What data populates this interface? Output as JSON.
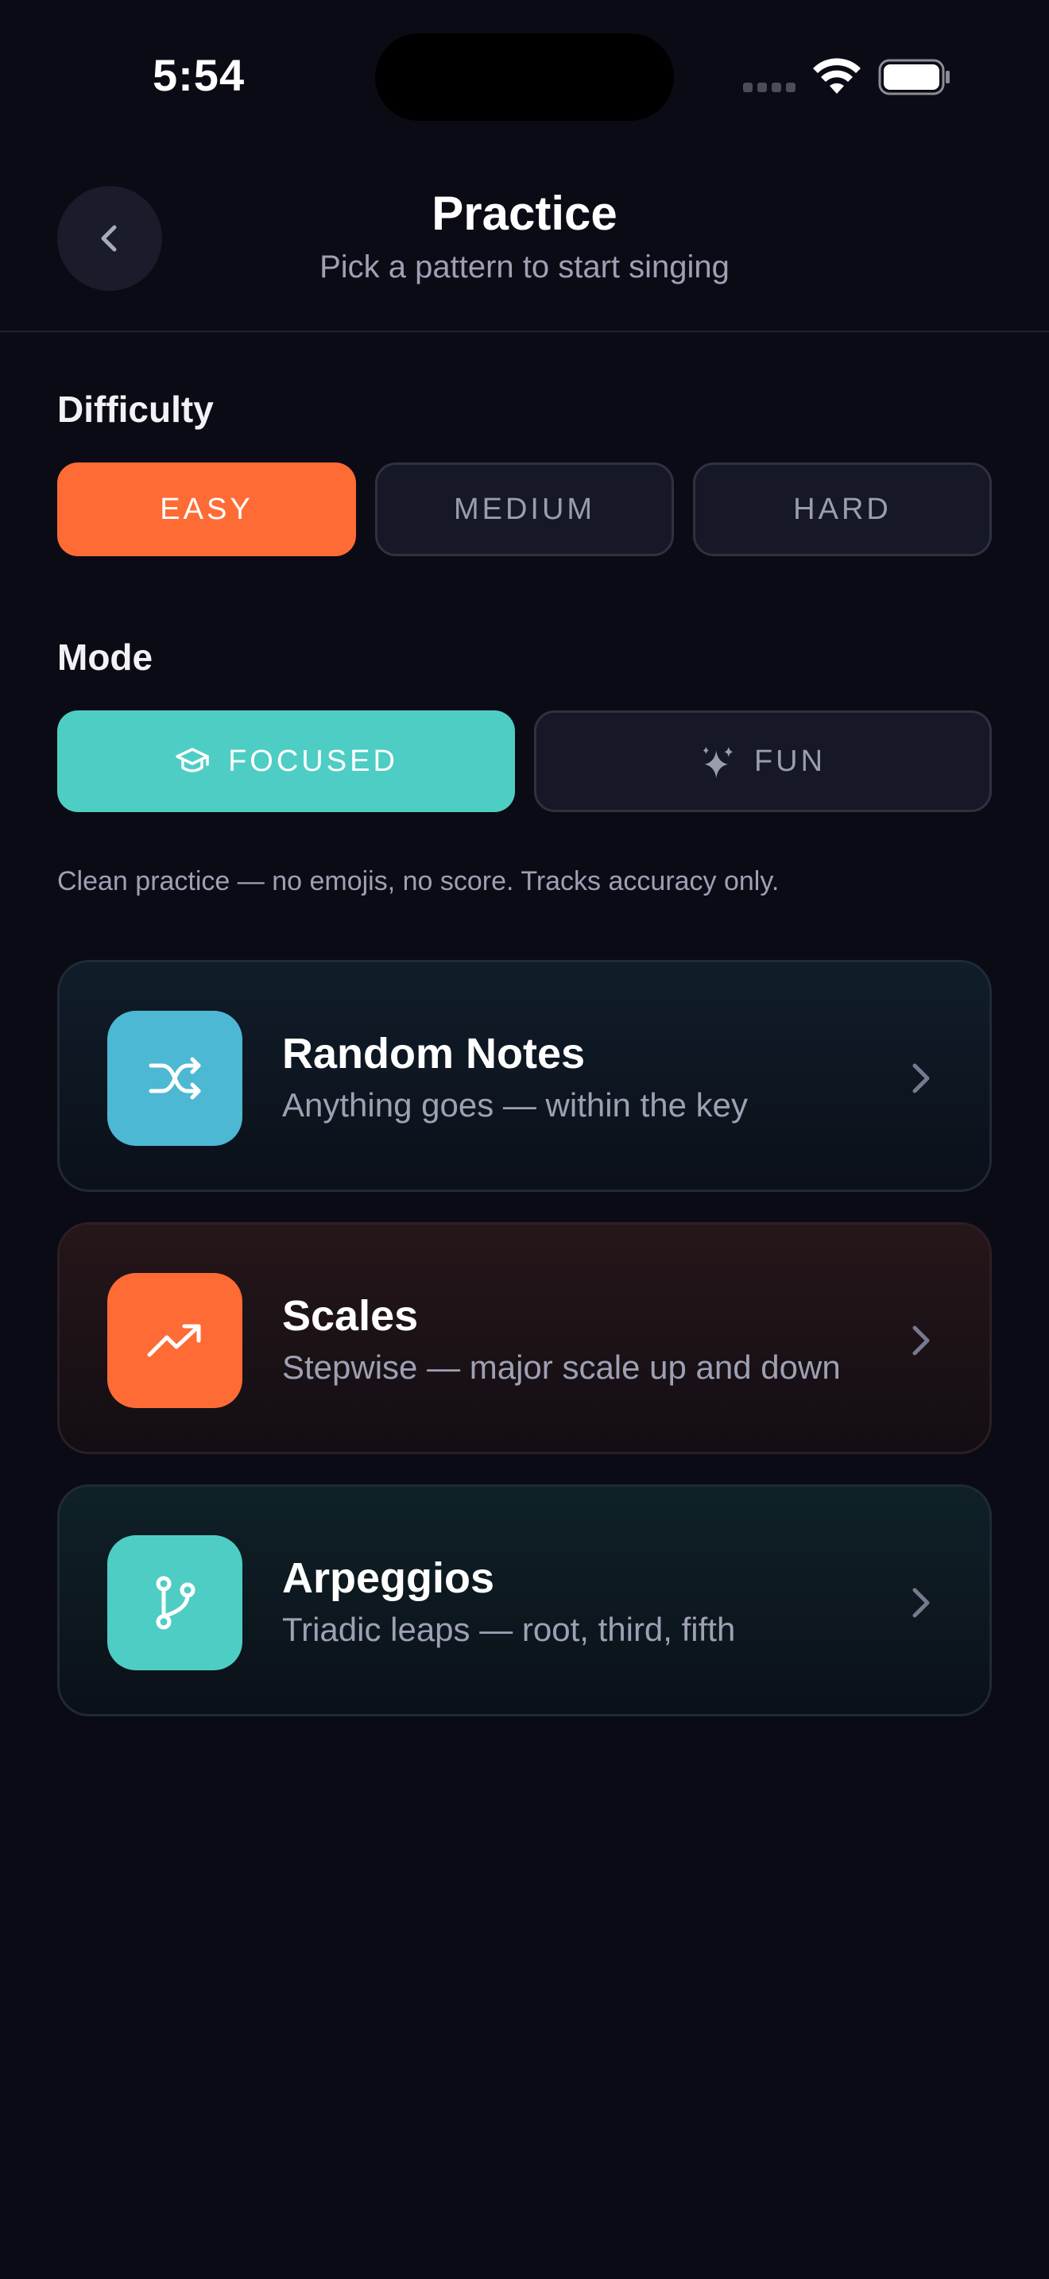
{
  "status_bar": {
    "time": "5:54"
  },
  "header": {
    "title": "Practice",
    "subtitle": "Pick a pattern to start singing"
  },
  "difficulty": {
    "label": "Difficulty",
    "options": [
      "EASY",
      "MEDIUM",
      "HARD"
    ],
    "selected": "EASY"
  },
  "mode": {
    "label": "Mode",
    "options": [
      {
        "label": "FOCUSED",
        "icon": "graduation-cap-icon"
      },
      {
        "label": "FUN",
        "icon": "sparkles-icon"
      }
    ],
    "selected": "FOCUSED",
    "description": "Clean practice — no emojis, no score. Tracks accuracy only."
  },
  "patterns": [
    {
      "title": "Random Notes",
      "subtitle": "Anything goes — within the key",
      "icon": "shuffle-icon",
      "color": "#4db8d4"
    },
    {
      "title": "Scales",
      "subtitle": "Stepwise — major scale up and down",
      "icon": "trending-up-icon",
      "color": "#ff6b35"
    },
    {
      "title": "Arpeggios",
      "subtitle": "Triadic leaps — root, third, fifth",
      "icon": "git-branch-icon",
      "color": "#4ecdc4"
    }
  ],
  "colors": {
    "background": "#0b0b15",
    "accent_orange": "#ff6b35",
    "accent_teal": "#4ecdc4",
    "accent_blue": "#4db8d4"
  }
}
